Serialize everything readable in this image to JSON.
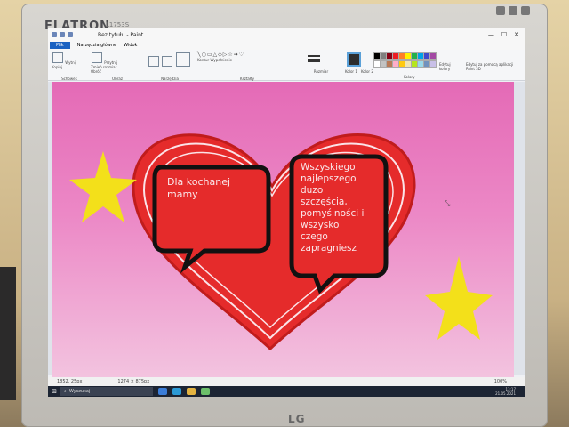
{
  "monitor": {
    "brand": "FLATRON",
    "model": "L1753S",
    "maker": "LG"
  },
  "window": {
    "title": "Bez tytułu - Paint",
    "controls": [
      "—",
      "☐",
      "✕"
    ]
  },
  "ribbon": {
    "tabs": [
      "Plik",
      "Narzędzia główne",
      "Widok"
    ],
    "groups": [
      "Schowek",
      "Obraz",
      "Narzędzia",
      "Kształty",
      "Kolory"
    ],
    "clipboard": [
      "Wklej",
      "Wytnij",
      "Kopiuj"
    ],
    "image": [
      "Zaznacz",
      "Przytnij",
      "Zmień rozmiar",
      "Obróć"
    ],
    "shapes_labels": [
      "Kontur",
      "Wypełnienie"
    ],
    "size_label": "Rozmiar",
    "color1_label": "Kolor 1",
    "color2_label": "Kolor 2",
    "edit_colors": "Edytuj kolory",
    "paint3d": "Edytuj za pomocą aplikacji Paint 3D",
    "palette": [
      "#000000",
      "#7f7f7f",
      "#880015",
      "#ed1c24",
      "#ff7f27",
      "#fff200",
      "#22b14c",
      "#00a2e8",
      "#3f48cc",
      "#a349a4",
      "#ffffff",
      "#c3c3c3",
      "#b97a57",
      "#ffaec9",
      "#ffc90e",
      "#efe4b0",
      "#b5e61d",
      "#99d9ea",
      "#7092be",
      "#c8bfe7"
    ]
  },
  "canvas": {
    "bubble_left": "Dla kochanej\nmamy",
    "bubble_right": "Wszyskiego\nnajlepszego\nduzo\nszczęścia,\npomyślności i\nwszysko\nczego\nzapragniesz",
    "colors": {
      "background_top": "#e46ab6",
      "heart": "#e22a2a",
      "star": "#f5e21a"
    }
  },
  "status": {
    "pos": "1852, 25px",
    "size": "1274 × 875px",
    "zoom": "100%"
  },
  "taskbar": {
    "search": "Wyszukaj",
    "time": "13:17",
    "date": "21.05.2021"
  }
}
